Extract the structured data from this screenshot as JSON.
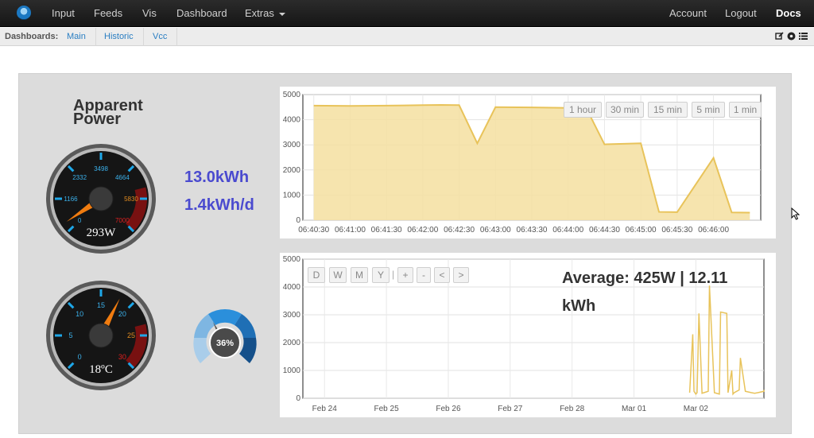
{
  "navbar": {
    "items": [
      "Input",
      "Feeds",
      "Vis",
      "Dashboard",
      "Extras"
    ],
    "right_items": [
      "Account",
      "Logout",
      "Docs"
    ]
  },
  "subnav": {
    "label": "Dashboards:",
    "links": [
      "Main",
      "Historic",
      "Vcc"
    ],
    "icons": [
      "edit-icon",
      "settings-icon",
      "list-icon"
    ]
  },
  "widgets": {
    "power_title": "Apparent Power",
    "power_title_line1": "Apparent",
    "power_title_line2": "Power",
    "kwh_total": "13.0kWh",
    "kwh_daily": "1.4kWh/d",
    "power_dial": {
      "value_label": "293W",
      "value": 293,
      "max": 7000,
      "ticks": [
        "0",
        "1166",
        "2332",
        "3498",
        "4664",
        "5830",
        "7000"
      ]
    },
    "temp_dial": {
      "value_label": "18ºC",
      "value": 18,
      "max": 30,
      "ticks": [
        "0",
        "5",
        "10",
        "15",
        "20",
        "25",
        "30"
      ]
    },
    "percent_gauge": {
      "label": "36%",
      "value": 36
    }
  },
  "realtime_chart": {
    "buttons": [
      "1 hour",
      "30 min",
      "15 min",
      "5 min",
      "1 min"
    ]
  },
  "history_chart": {
    "buttons": [
      "D",
      "W",
      "M",
      "Y",
      "+",
      "-",
      "<",
      ">"
    ],
    "average_text": "Average: 425W | 12.11 kWh"
  },
  "colors": {
    "accent": "#4a4acf",
    "series_fill": "#f5dfa0",
    "series_line": "#e8c35a",
    "navbar": "#1b1b1b",
    "link": "#2a7ec2"
  },
  "chart_data": [
    {
      "type": "area",
      "title": "",
      "x": [
        "06:40:30",
        "06:41:00",
        "06:41:30",
        "06:42:00",
        "06:42:15",
        "06:42:30",
        "06:42:45",
        "06:43:00",
        "06:43:30",
        "06:44:00",
        "06:44:15",
        "06:44:30",
        "06:45:00",
        "06:45:15",
        "06:45:30",
        "06:46:00",
        "06:46:15",
        "06:46:30"
      ],
      "xticks": [
        "06:40:30",
        "06:41:00",
        "06:41:30",
        "06:42:00",
        "06:42:30",
        "06:43:00",
        "06:43:30",
        "06:44:00",
        "06:44:30",
        "06:45:00",
        "06:45:30",
        "06:46:00"
      ],
      "series": [
        {
          "values": [
            4560,
            4550,
            4560,
            4580,
            4590,
            4580,
            3060,
            4500,
            4490,
            4470,
            4460,
            3020,
            3060,
            330,
            320,
            2480,
            310,
            300
          ]
        }
      ],
      "ylim": [
        0,
        5000
      ],
      "yticks": [
        0,
        1000,
        2000,
        3000,
        4000,
        5000
      ],
      "grid": true
    },
    {
      "type": "line",
      "title": "",
      "x_days": [
        "Feb 24",
        "Feb 25",
        "Feb 26",
        "Feb 27",
        "Feb 28",
        "Mar 01",
        "Mar 02"
      ],
      "series": [
        {
          "values_day_offsets": [
            5.9,
            5.95,
            5.97,
            6.0,
            6.02,
            6.05,
            6.1,
            6.2,
            6.22,
            6.3,
            6.38,
            6.4,
            6.5,
            6.52,
            6.58,
            6.6,
            6.62,
            6.7,
            6.72,
            6.8,
            6.9,
            6.95,
            7.0,
            7.1,
            7.3
          ],
          "values": [
            200,
            2300,
            250,
            150,
            200,
            3050,
            180,
            250,
            4050,
            200,
            150,
            3100,
            3050,
            200,
            1000,
            150,
            200,
            300,
            1450,
            250,
            200,
            180,
            200,
            250,
            300
          ]
        }
      ],
      "ylim": [
        0,
        5000
      ],
      "yticks": [
        0,
        1000,
        2000,
        3000,
        4000,
        5000
      ],
      "grid": true
    }
  ]
}
